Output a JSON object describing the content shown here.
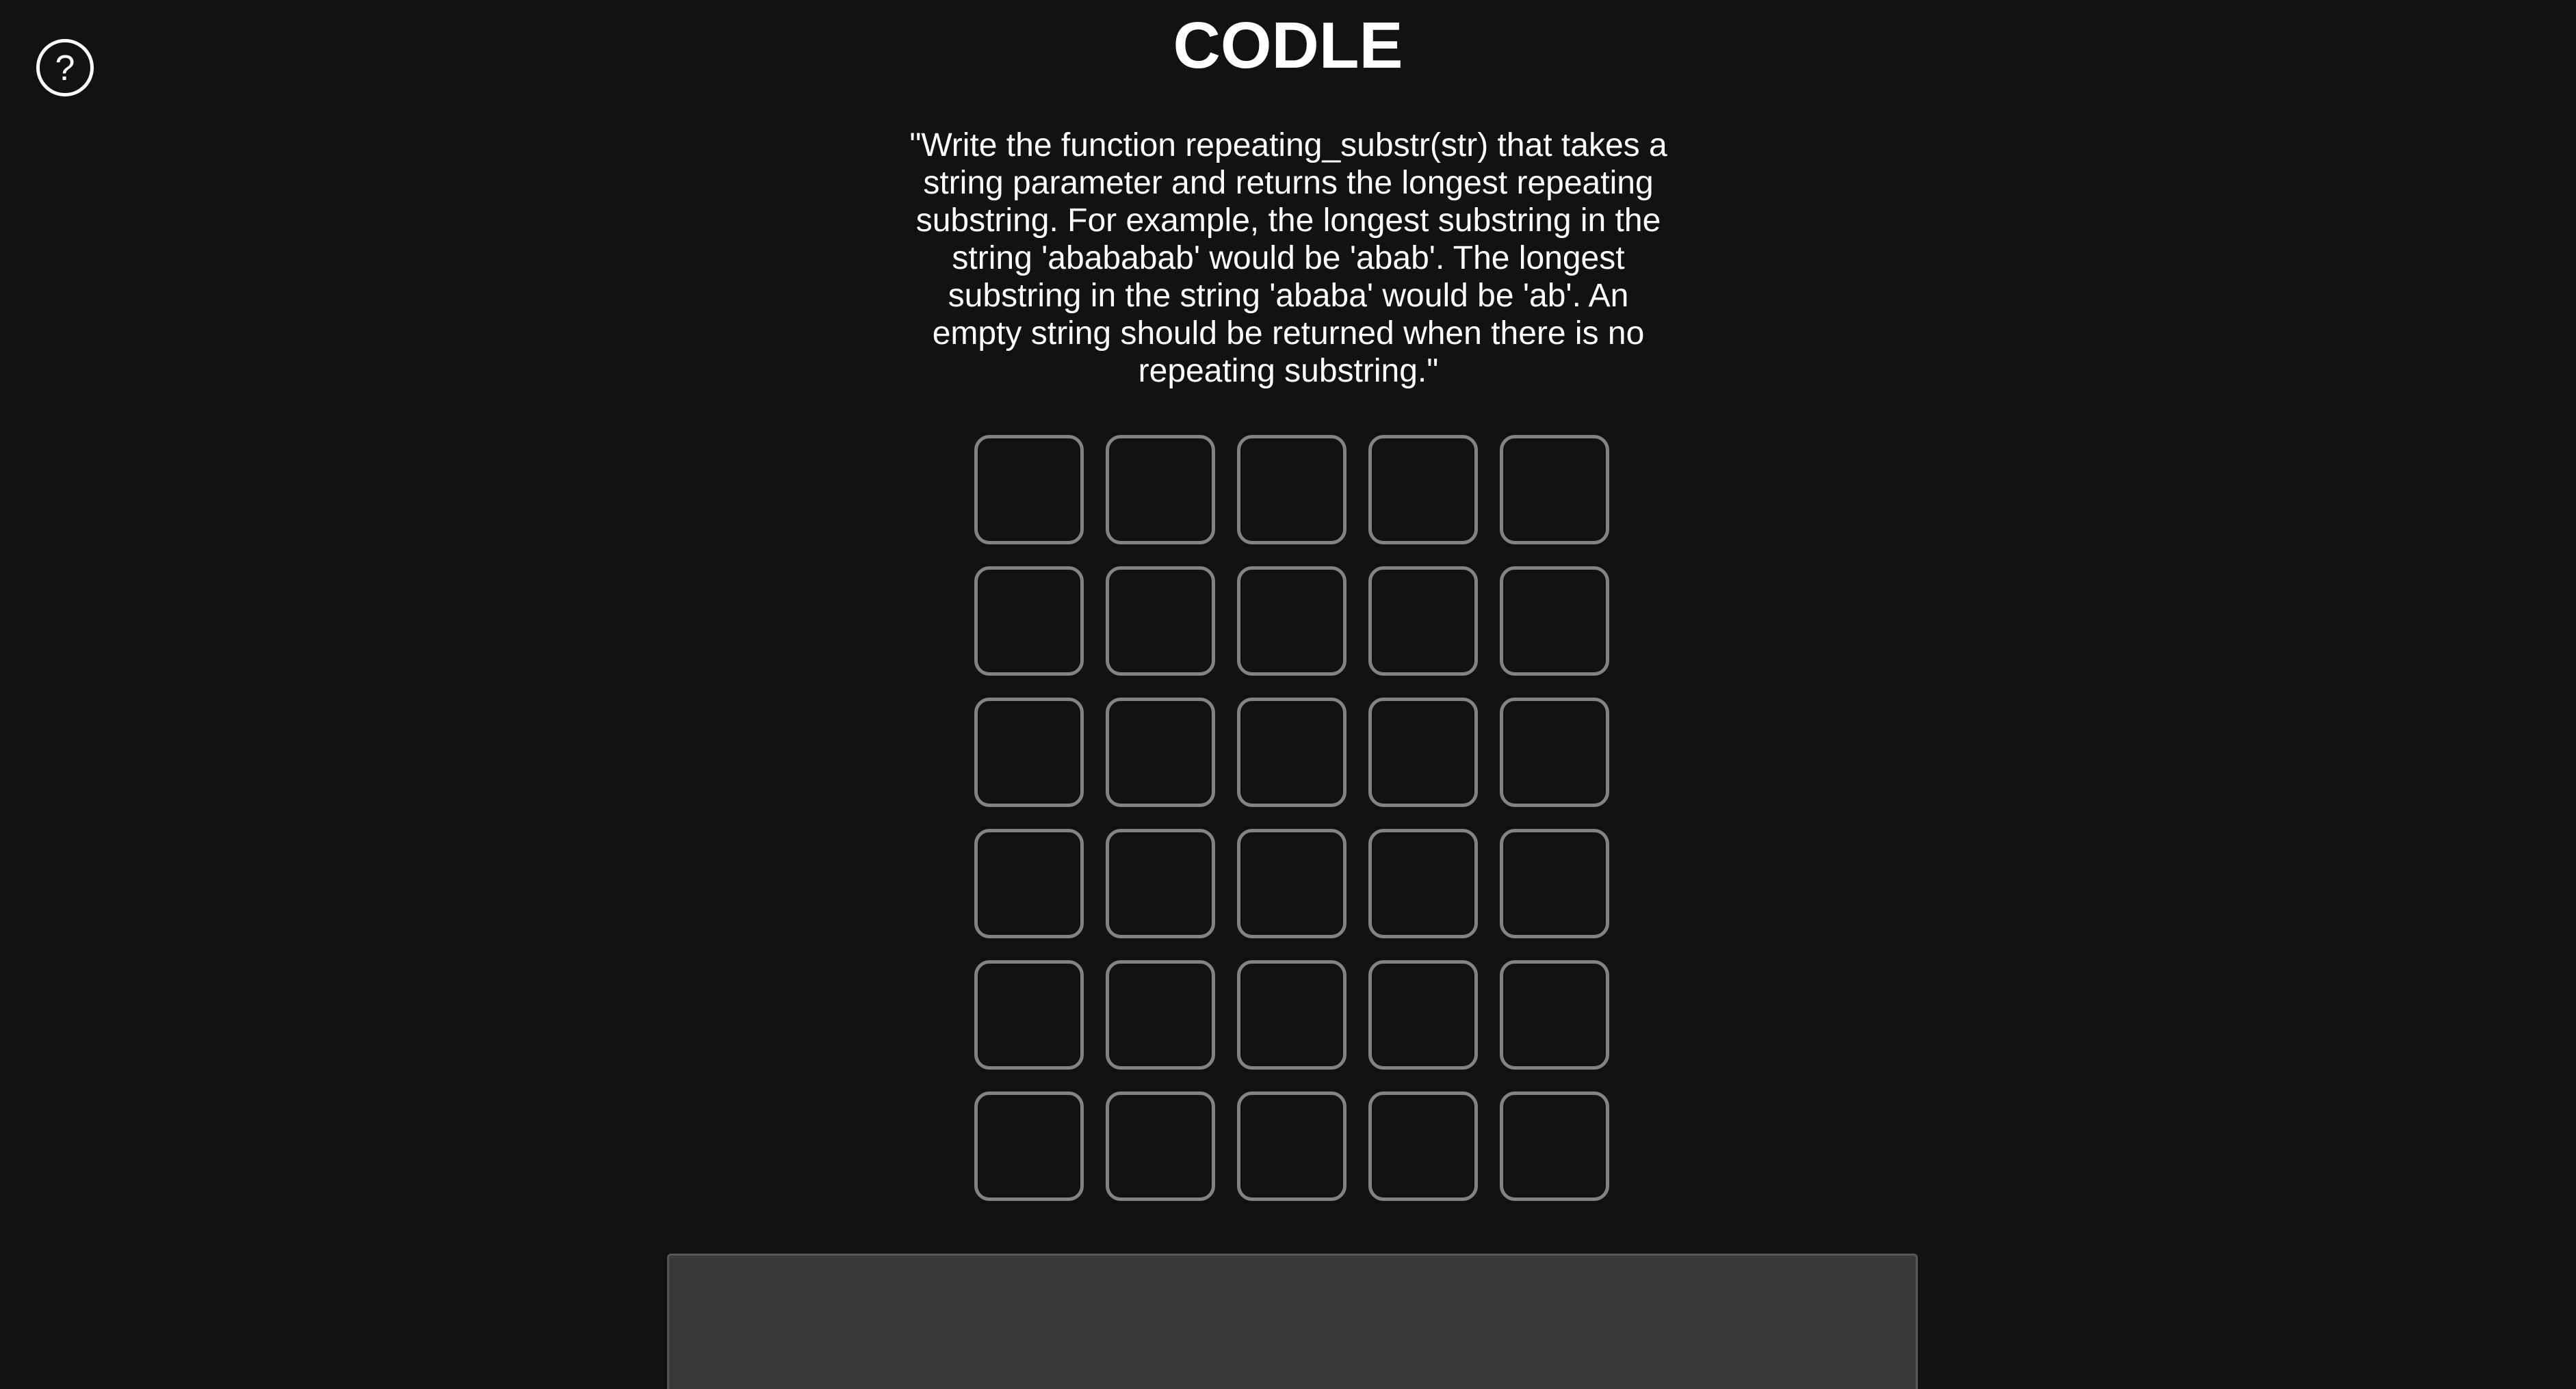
{
  "header": {
    "title": "CODLE",
    "help_glyph": "?"
  },
  "prompt": {
    "text": "\"Write the function repeating_substr(str) that takes a string parameter and returns the longest repeating substring. For example, the longest substring in the string 'abababab' would be 'abab'. The longest substring in the string 'ababa' would be 'ab'. An empty string should be returned when there is no repeating substring.\""
  },
  "board": {
    "rows": [
      [
        "",
        "",
        "",
        "",
        ""
      ],
      [
        "",
        "",
        "",
        "",
        ""
      ],
      [
        "",
        "",
        "",
        "",
        ""
      ],
      [
        "",
        "",
        "",
        "",
        ""
      ],
      [
        "",
        "",
        "",
        "",
        ""
      ],
      [
        "",
        "",
        "",
        "",
        ""
      ]
    ]
  },
  "editor": {
    "value": ""
  },
  "colors": {
    "background": "#121214",
    "tile_border": "#818384",
    "editor_background": "#3a3a3c",
    "text": "#ffffff"
  },
  "icons": {
    "help": "question-mark-circle-icon"
  }
}
